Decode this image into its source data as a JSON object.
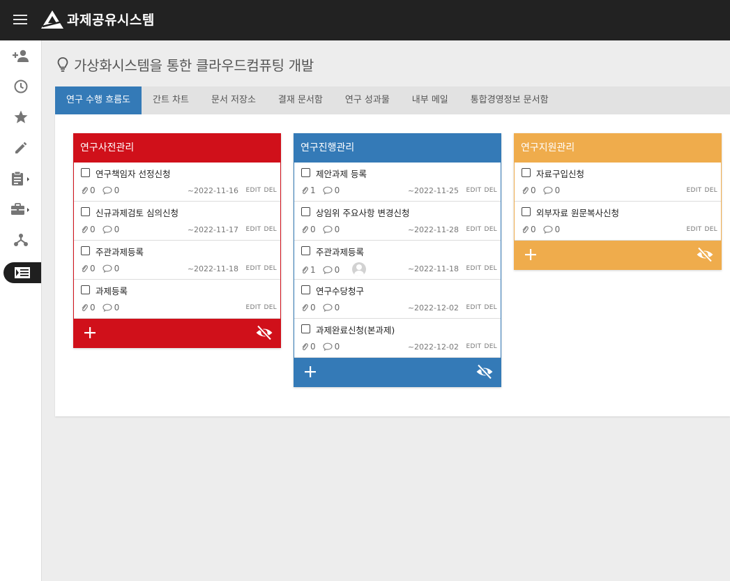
{
  "header": {
    "app_title": "과제공유시스템",
    "menu_icon": "hamburger-menu-icon",
    "logo_icon": "triangle-logo-icon"
  },
  "sidebar": {
    "items": [
      {
        "icon": "person-add-icon"
      },
      {
        "icon": "clock-icon"
      },
      {
        "icon": "star-icon"
      },
      {
        "icon": "pencil-icon"
      },
      {
        "icon": "clipboard-icon"
      },
      {
        "icon": "briefcase-icon"
      },
      {
        "icon": "hierarchy-icon"
      },
      {
        "icon": "list-icon",
        "active": true
      }
    ]
  },
  "page": {
    "title": "가상화시스템을 통한 클라우드컴퓨팅 개발",
    "title_icon": "lightbulb-icon"
  },
  "tabs": [
    {
      "label": "연구 수행 흐름도",
      "active": true
    },
    {
      "label": "간트 차트"
    },
    {
      "label": "문서 저장소"
    },
    {
      "label": "결재 문서함"
    },
    {
      "label": "연구 성과물"
    },
    {
      "label": "내부 메일"
    },
    {
      "label": "통합경영정보 문서함"
    }
  ],
  "labels": {
    "edit": "EDIT",
    "del": "DEL"
  },
  "colors": {
    "red": "#d0101a",
    "blue": "#347ab7",
    "orange": "#efac4c",
    "tab_active": "#347ab7"
  },
  "boards": [
    {
      "title": "연구사전관리",
      "color": "#d0101a",
      "cards": [
        {
          "title": "연구책임자 선정신청",
          "attachments": "0",
          "comments": "0",
          "date": "~2022-11-16"
        },
        {
          "title": "신규과제검토 심의신청",
          "attachments": "0",
          "comments": "0",
          "date": "~2022-11-17"
        },
        {
          "title": "주관과제등록",
          "attachments": "0",
          "comments": "0",
          "date": "~2022-11-18"
        },
        {
          "title": "과제등록",
          "attachments": "0",
          "comments": "0",
          "date": ""
        }
      ]
    },
    {
      "title": "연구진행관리",
      "color": "#347ab7",
      "cards": [
        {
          "title": "제안과제 등록",
          "attachments": "1",
          "comments": "0",
          "date": "~2022-11-25"
        },
        {
          "title": "상임위 주요사항 변경신청",
          "attachments": "0",
          "comments": "0",
          "date": "~2022-11-28"
        },
        {
          "title": "주관과제등록",
          "attachments": "1",
          "comments": "0",
          "date": "~2022-11-18",
          "avatar": true
        },
        {
          "title": "연구수당청구",
          "attachments": "0",
          "comments": "0",
          "date": "~2022-12-02"
        },
        {
          "title": "과제완료신청(본과제)",
          "attachments": "0",
          "comments": "0",
          "date": "~2022-12-02"
        }
      ]
    },
    {
      "title": "연구지원관리",
      "color": "#efac4c",
      "cards": [
        {
          "title": "자료구입신청",
          "attachments": "0",
          "comments": "0",
          "date": ""
        },
        {
          "title": "외부자료 원문복사신청",
          "attachments": "0",
          "comments": "0",
          "date": ""
        }
      ]
    }
  ]
}
